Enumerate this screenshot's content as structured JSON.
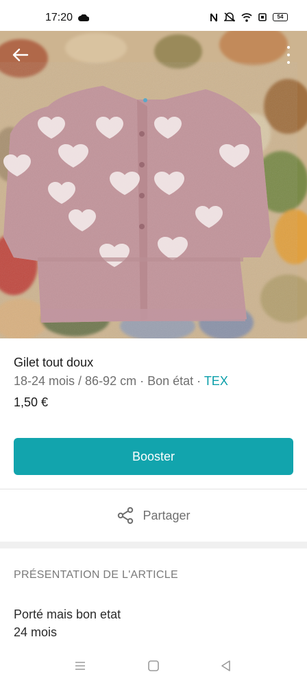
{
  "status_bar": {
    "time": "17:20",
    "battery": "54",
    "icons": [
      "cloud-icon",
      "nfc-icon",
      "mute-icon",
      "wifi-icon",
      "sim-icon",
      "battery-icon"
    ]
  },
  "photo": {
    "icons": [
      "back-arrow-icon",
      "more-vertical-icon"
    ]
  },
  "item": {
    "title": "Gilet tout doux",
    "size": "18-24 mois / 86-92 cm",
    "condition": "Bon état",
    "brand": "TEX",
    "separator": " · ",
    "price": "1,50 €"
  },
  "actions": {
    "boost_label": "Booster",
    "share_label": "Partager"
  },
  "description_section": {
    "header": "PRÉSENTATION DE L'ARTICLE",
    "lines": [
      "Porté mais bon etat",
      "24 mois"
    ]
  },
  "colors": {
    "accent": "#12a4ad",
    "brand_link": "#0a9ea9"
  },
  "nav_bar": {
    "icons": [
      "menu-icon",
      "home-square-icon",
      "back-triangle-icon"
    ]
  }
}
